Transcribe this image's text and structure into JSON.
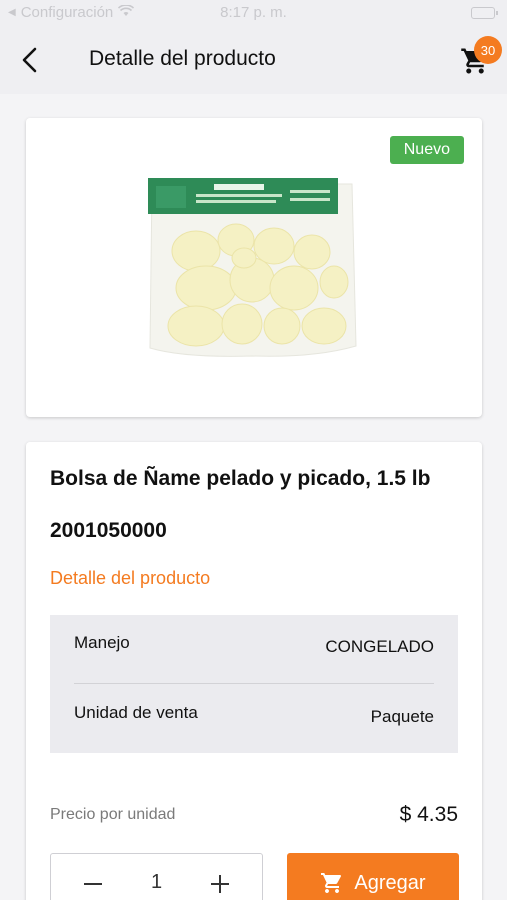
{
  "status_bar": {
    "carrier": "Configuración",
    "time": "8:17 p. m."
  },
  "header": {
    "title": "Detalle del producto",
    "back_icon": "chevron-left-icon",
    "cart_icon": "shopping-cart-icon",
    "cart_count": "30"
  },
  "product": {
    "badge": "Nuevo",
    "name": "Bolsa de Ñame pelado y picado, 1.5 lb",
    "code": "2001050000",
    "image": "product-bag-image",
    "detail_link": "Detalle del producto",
    "specs": [
      {
        "label": "Manejo",
        "value": "CONGELADO"
      },
      {
        "label": "Unidad de venta",
        "value": "Paquete"
      }
    ],
    "price_label": "Precio por unidad",
    "price": "$ 4.35",
    "quantity": "1",
    "add_button_label": "Agregar"
  },
  "colors": {
    "accent": "#f47b20",
    "badge_green": "#4caf50",
    "background": "#f4f4f6",
    "spec_bg": "#ebebef"
  }
}
